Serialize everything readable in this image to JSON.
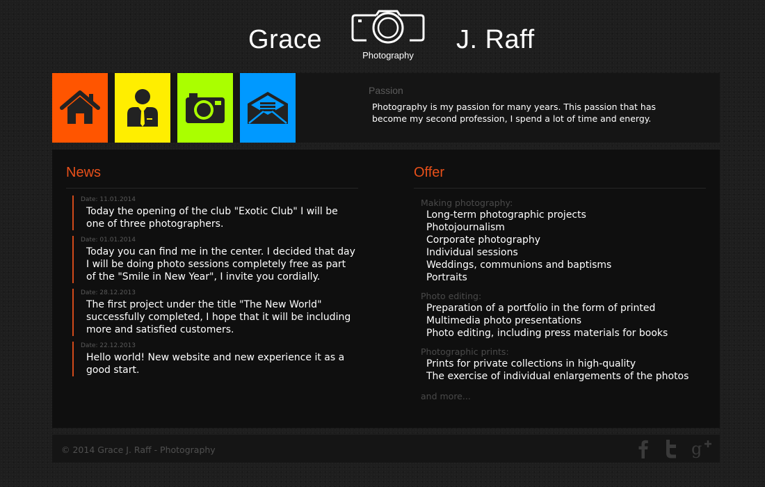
{
  "header": {
    "first_name": "Grace",
    "last_name": "J. Raff",
    "logo_caption": "Photography"
  },
  "nav": {
    "tiles": [
      {
        "name": "home",
        "icon": "home-icon",
        "color": "#ff5500"
      },
      {
        "name": "about",
        "icon": "person-icon",
        "color": "#ffee00"
      },
      {
        "name": "gallery",
        "icon": "camera-icon",
        "color": "#aaff00"
      },
      {
        "name": "contact",
        "icon": "envelope-icon",
        "color": "#0099ff"
      }
    ]
  },
  "passion": {
    "title": "Passion",
    "text": "Photography is my passion for many years. This passion that has become my second profession, I spend a lot of time and energy."
  },
  "news": {
    "title": "News",
    "items": [
      {
        "date": "Date: 11.01.2014",
        "text": "Today the opening of the club \"Exotic Club\" I will be one of three photographers."
      },
      {
        "date": "Date: 01.01.2014",
        "text": "Today you can find me in the center. I decided that day I will be doing photo sessions completely free as part of the \"Smile in New Year\", I invite you cordially."
      },
      {
        "date": "Date: 28.12.2013",
        "text": "The first project under the title \"The New World\" successfully completed, I hope that it will be including more and satisfied customers."
      },
      {
        "date": "Date: 22.12.2013",
        "text": "Hello world! New website and new experience it as a good start."
      }
    ]
  },
  "offer": {
    "title": "Offer",
    "groups": [
      {
        "title": "Making photography:",
        "items": [
          "Long-term photographic projects",
          "Photojournalism",
          "Corporate photography",
          "Individual sessions",
          "Weddings, communions and baptisms",
          "Portraits"
        ]
      },
      {
        "title": "Photo editing:",
        "items": [
          "Preparation of a portfolio in the form of printed",
          "Multimedia photo presentations",
          "Photo editing, including press materials for books"
        ]
      },
      {
        "title": "Photographic prints:",
        "items": [
          "Prints for private collections in high-quality",
          "The exercise of individual enlargements of the photos"
        ]
      }
    ],
    "more": "and more..."
  },
  "footer": {
    "copyright": "© 2014 Grace J. Raff - Photography",
    "social": [
      "facebook-icon",
      "twitter-icon",
      "google-plus-icon"
    ]
  },
  "colors": {
    "accent": "#e8501a",
    "muted": "#4a4a4a",
    "panel": "#0f0f0f"
  }
}
